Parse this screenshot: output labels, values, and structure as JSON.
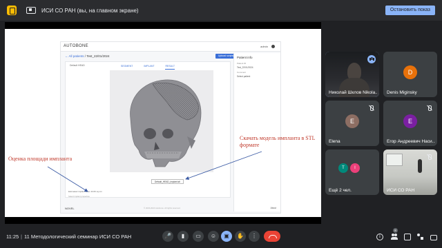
{
  "share_banner": {
    "text": "ИСИ СО РАН (вы, на главном экране)",
    "stop_label": "Остановить показ"
  },
  "slide": {
    "app": {
      "brand": "AUTOBONE",
      "user": "admin",
      "crumb_link": "← All patients",
      "crumb_current": "/ Test_22/01/2024",
      "upload_label": "Upload scripts",
      "select_text": "Default HEAD",
      "tabs": [
        "SEGMENT",
        "IMPLANT",
        "RESULT"
      ],
      "active_tab": 2,
      "download_label": "Default_HEAD_implant.stl",
      "area_label": "Estimated implant area: 43.06 sq.cm",
      "area_sub": "Select implant properties",
      "footer_brand": "NOVEL",
      "copyright": "© 2023-2024 Autobone. All rights reserved.",
      "about": "About",
      "patient_panel": {
        "title": "Patient info",
        "lines": [
          {
            "label": "Patient ID",
            "value": "Test_22/01/2024"
          },
          {
            "label": "Comment",
            "value": "Select patient"
          }
        ]
      }
    },
    "annotations": {
      "left": "Оценка площади импланта",
      "right": "Скачать модель импланта в STL формате"
    }
  },
  "participants": [
    {
      "name": "Николай Шклов Nikola...",
      "initial": "",
      "video": "dark",
      "mic": "speaking",
      "active": true
    },
    {
      "name": "Denis Miginsky",
      "initial": "D",
      "color": "#e8710a",
      "mic": "none",
      "active": false
    },
    {
      "name": "Elena",
      "initial": "E",
      "color": "#8d6e63",
      "mic": "muted",
      "active": false
    },
    {
      "name": "Егор Андреевич Наси...",
      "initial": "E",
      "color": "#7b1fa2",
      "mic": "muted",
      "active": false
    },
    {
      "name": "Ещё 2 чел.",
      "initials": [
        "T",
        "I"
      ],
      "colors": [
        "#00897b",
        "#ec407a"
      ],
      "mic": "none",
      "active": false
    },
    {
      "name": "ИСИ СО РАН",
      "initial": "",
      "video": "room",
      "mic": "muted",
      "active": false
    }
  ],
  "bottom_bar": {
    "time": "11:25",
    "separator": "|",
    "meeting_title": "11 Методологический семинар ИСИ СО РАН",
    "participant_count": "8",
    "controls": [
      {
        "name": "mic",
        "glyph": "🎤",
        "style": "gray"
      },
      {
        "name": "camera",
        "glyph": "▮",
        "style": "gray"
      },
      {
        "name": "captions",
        "glyph": "▭",
        "style": "gray"
      },
      {
        "name": "emoji",
        "glyph": "☺",
        "style": "gray"
      },
      {
        "name": "present",
        "glyph": "▣",
        "style": "blue"
      },
      {
        "name": "raise-hand",
        "glyph": "✋",
        "style": "gray"
      },
      {
        "name": "more",
        "glyph": "⋮",
        "style": "gray"
      }
    ]
  }
}
